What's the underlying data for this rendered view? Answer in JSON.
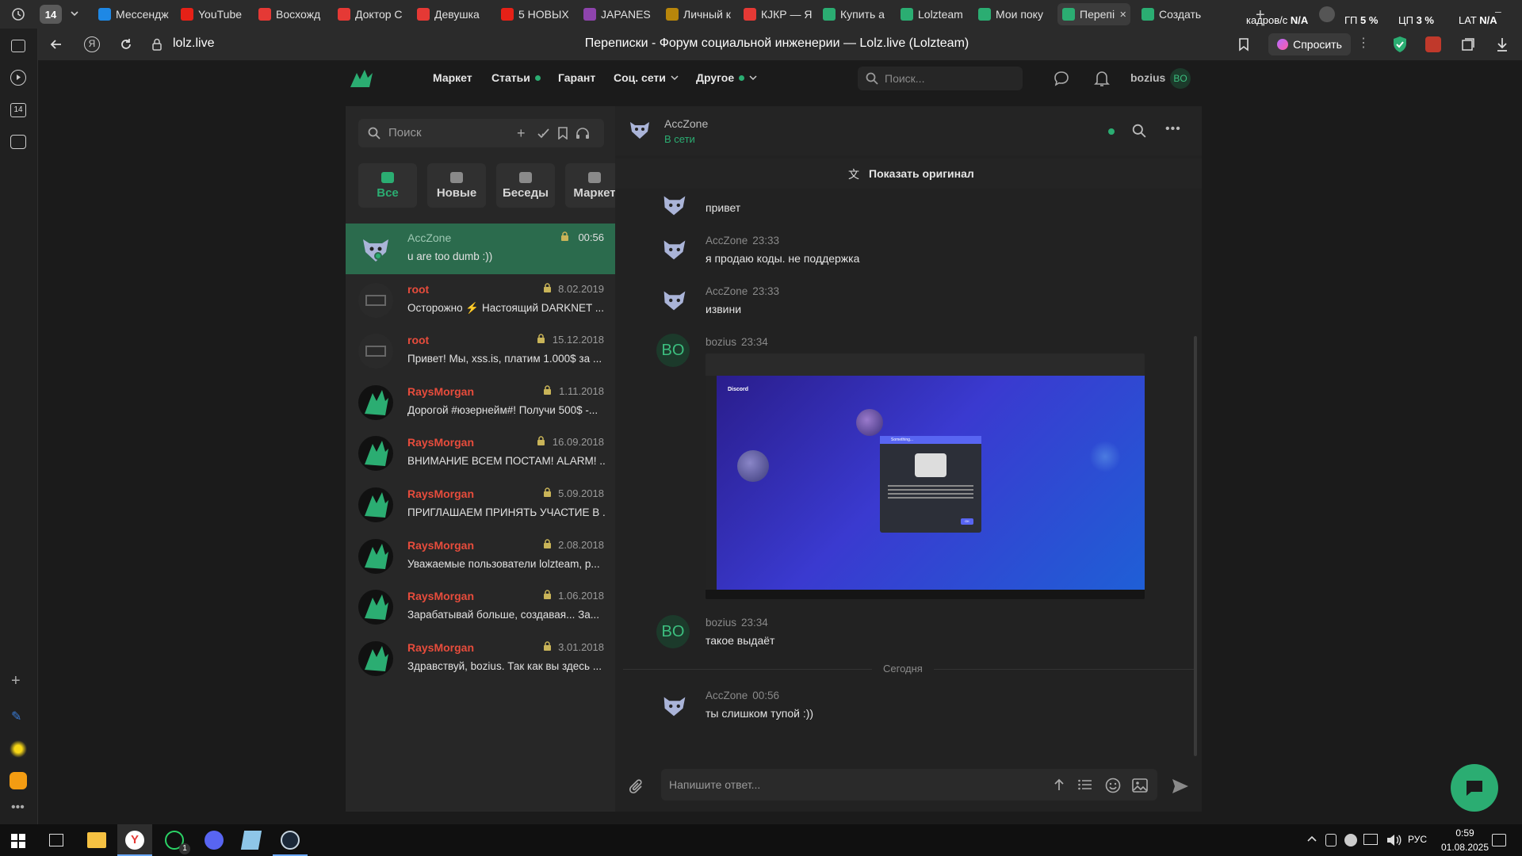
{
  "browser": {
    "tab_count": "14",
    "tabs": [
      {
        "label": "Мессендж",
        "icon": "messenger-icon",
        "color": "#1e88e5"
      },
      {
        "label": "YouTube",
        "icon": "youtube-icon",
        "color": "#e62117"
      },
      {
        "label": "Восхожд",
        "icon": "a-icon",
        "color": "#e53935"
      },
      {
        "label": "Доктор С",
        "icon": "a-icon",
        "color": "#e53935"
      },
      {
        "label": "Девушка",
        "icon": "a-icon",
        "color": "#e53935"
      },
      {
        "label": "5 НОВЫХ",
        "icon": "youtube-icon",
        "color": "#e62117"
      },
      {
        "label": "JAPANES",
        "icon": "twitch-icon",
        "color": "#8e44ad"
      },
      {
        "label": "Личный к",
        "icon": "shield-icon",
        "color": "#b8860b"
      },
      {
        "label": "КJКР — Я",
        "icon": "yandex-icon",
        "color": "#e53935"
      },
      {
        "label": "Купить а",
        "icon": "lolz-icon",
        "color": "#2bad72"
      },
      {
        "label": "Lolzteam",
        "icon": "lolz-icon",
        "color": "#2bad72"
      },
      {
        "label": "Мои поку",
        "icon": "lolz-icon",
        "color": "#2bad72"
      },
      {
        "label": "Перепі",
        "icon": "lolz-icon",
        "color": "#2bad72",
        "active": true
      },
      {
        "label": "Создать",
        "icon": "lolz-icon",
        "color": "#2bad72"
      }
    ],
    "sys": {
      "net_label": "кадров/с",
      "net_value": "N/A",
      "gpu_label": "ГП",
      "gpu_value": "5 %",
      "cpu_label": "ЦП",
      "cpu_value": "3 %",
      "lat_label": "LAT",
      "lat_value": "N/A"
    },
    "address": "lolz.live",
    "page_title": "Переписки - Форум социальной инженерии — Lolz.live (Lolzteam)",
    "ask_label": "Спросить",
    "sidebar_badge": "14"
  },
  "site": {
    "nav": [
      {
        "label": "Маркет",
        "dot": false,
        "chevron": false
      },
      {
        "label": "Статьи",
        "dot": true,
        "chevron": false
      },
      {
        "label": "Гарант",
        "dot": false,
        "chevron": false
      },
      {
        "label": "Соц. сети",
        "dot": false,
        "chevron": true
      },
      {
        "label": "Другое",
        "dot": true,
        "chevron": true
      }
    ],
    "search_placeholder": "Поиск...",
    "username": "bozius",
    "user_initials": "BO",
    "accent": "#2bad72"
  },
  "conversations": {
    "search_placeholder": "Поиск",
    "categories": [
      {
        "label": "Все",
        "active": true
      },
      {
        "label": "Новые",
        "active": false
      },
      {
        "label": "Беседы",
        "active": false
      },
      {
        "label": "Маркет",
        "active": false
      }
    ],
    "items": [
      {
        "name": "AccZone",
        "date": "00:56",
        "message": "u are too dumb :))",
        "active": true,
        "avatar": "acczone"
      },
      {
        "name": "root",
        "date": "8.02.2019",
        "message": "Осторожно ⚡ Настоящий DARKNET ...",
        "active": false,
        "avatar": "lzt"
      },
      {
        "name": "root",
        "date": "15.12.2018",
        "message": "Привет! Мы, xss.is, платим 1.000$ за ...",
        "active": false,
        "avatar": "lzt"
      },
      {
        "name": "RaysMorgan",
        "date": "1.11.2018",
        "message": "Дорогой #юзернейм#! Получи 500$ -...",
        "active": false,
        "avatar": "rays"
      },
      {
        "name": "RaysMorgan",
        "date": "16.09.2018",
        "message": "ВНИМАНИЕ ВСЕМ ПОСТАМ! ALARM! ...",
        "active": false,
        "avatar": "rays"
      },
      {
        "name": "RaysMorgan",
        "date": "5.09.2018",
        "message": "ПРИГЛАШАЕМ ПРИНЯТЬ УЧАСТИЕ В ...",
        "active": false,
        "avatar": "rays"
      },
      {
        "name": "RaysMorgan",
        "date": "2.08.2018",
        "message": "Уважаемые пользователи lolzteam, р...",
        "active": false,
        "avatar": "rays"
      },
      {
        "name": "RaysMorgan",
        "date": "1.06.2018",
        "message": "Зарабатывай больше, создавая... За...",
        "active": false,
        "avatar": "rays"
      },
      {
        "name": "RaysMorgan",
        "date": "3.01.2018",
        "message": "Здравствуй, bozius. Так как вы здесь ...",
        "active": false,
        "avatar": "rays"
      }
    ]
  },
  "chat": {
    "contact_name": "AccZone",
    "contact_status": "В сети",
    "show_original": "Показать оригинал",
    "messages": [
      {
        "author": "AccZone",
        "time": "23:33",
        "text": "привет"
      },
      {
        "author": "AccZone",
        "time": "23:33",
        "text": "я продаю коды. не поддержка"
      },
      {
        "author": "AccZone",
        "time": "23:33",
        "text": "извини"
      },
      {
        "author": "bozius",
        "time": "23:34",
        "text": "",
        "image": "discord-screenshot"
      },
      {
        "author": "bozius",
        "time": "23:34",
        "text": "такое выдаёт"
      },
      {
        "author": "AccZone",
        "time": "00:56",
        "text": "ты слишком тупой :))"
      }
    ],
    "divider": "Сегодня",
    "embedded": {
      "app_name": "Discord",
      "dialog_title": "Something...",
      "dialog_button": "OK"
    },
    "reply_placeholder": "Напишите ответ..."
  },
  "taskbar": {
    "whatsapp_badge": "1",
    "lang": "РУС",
    "time": "0:59",
    "date": "01.08.2025"
  }
}
